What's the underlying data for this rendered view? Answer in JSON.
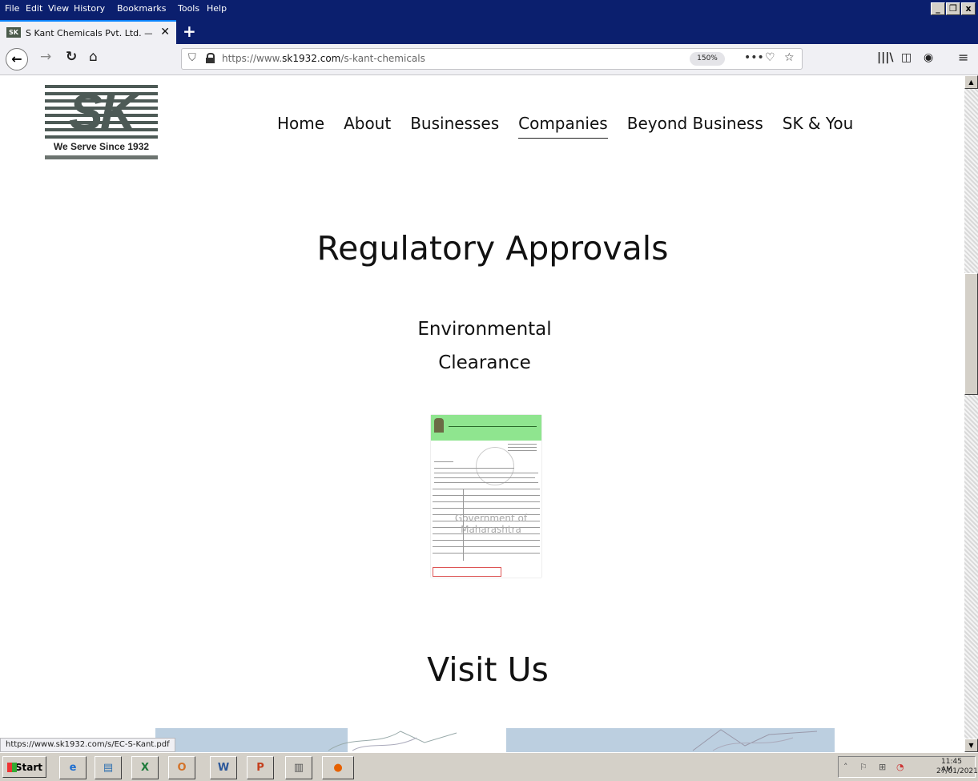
{
  "menubar": {
    "items": [
      "File",
      "Edit",
      "View",
      "History",
      "Bookmarks",
      "Tools",
      "Help"
    ],
    "window_buttons": [
      "_",
      "❐",
      "x"
    ]
  },
  "tab": {
    "favicon_text": "SK",
    "title": "S Kant Chemicals Pvt. Ltd. — SK Group",
    "close": "✕",
    "new_tab": "+"
  },
  "navbar": {
    "url_prefix": "https://www.",
    "url_domain": "sk1932.com",
    "url_path": "/s-kant-chemicals",
    "zoom": "150%"
  },
  "logo": {
    "letters": "SK",
    "tagline": "We Serve Since 1932"
  },
  "site_nav": {
    "items": [
      "Home",
      "About",
      "Businesses",
      "Companies",
      "Beyond Business",
      "SK & You"
    ],
    "active": "Companies"
  },
  "main": {
    "heading_regulatory": "Regulatory Approvals",
    "subheading_line1": "Environmental",
    "subheading_line2": "Clearance",
    "document_watermark": "Government of Maharashtra",
    "heading_visit": "Visit Us"
  },
  "statusbar": {
    "text": "https://www.sk1932.com/s/EC-S-Kant.pdf"
  },
  "taskbar": {
    "start_label": "Start",
    "clock_time": "11:45 AM",
    "clock_date": "27/01/2021"
  }
}
